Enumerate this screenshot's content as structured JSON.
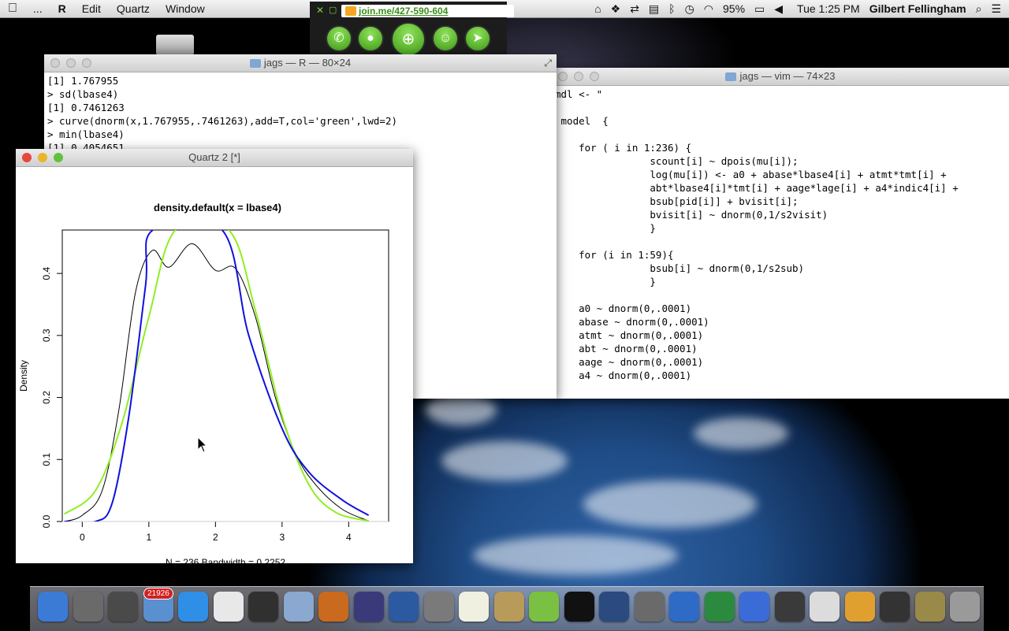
{
  "menubar": {
    "apple": "",
    "items": [
      "...",
      "R",
      "Edit",
      "Quartz",
      "Window"
    ],
    "battery": "95%",
    "clock": "Tue 1:25 PM",
    "user": "Gilbert Fellingham"
  },
  "joinme": {
    "url": "join.me/427-590-604"
  },
  "r_console": {
    "title": "jags — R — 80×24",
    "lines": [
      "[1] 1.767955",
      "> sd(lbase4)",
      "[1] 0.7461263",
      "> curve(dnorm(x,1.767955,.7461263),add=T,col='green',lwd=2)",
      "> min(lbase4)",
      "[1] 0.4054651"
    ]
  },
  "vim": {
    "title": "jags — vim — 74×23",
    "lines": [
      "mdl <- \"",
      "",
      " model  {",
      "",
      "    for ( i in 1:236) {",
      "                scount[i] ~ dpois(mu[i]);",
      "                log(mu[i]) <- a0 + abase*lbase4[i] + atmt*tmt[i] +",
      "                abt*lbase4[i]*tmt[i] + aage*lage[i] + a4*indic4[i] +",
      "                bsub[pid[i]] + bvisit[i];",
      "                bvisit[i] ~ dnorm(0,1/s2visit)",
      "                }",
      "",
      "    for (i in 1:59){",
      "                bsub[i] ~ dnorm(0,1/s2sub)",
      "                }",
      "",
      "    a0 ~ dnorm(0,.0001)",
      "    abase ~ dnorm(0,.0001)",
      "    atmt ~ dnorm(0,.0001)",
      "    abt ~ dnorm(0,.0001)",
      "    aage ~ dnorm(0,.0001)",
      "    a4 ~ dnorm(0,.0001)"
    ]
  },
  "quartz": {
    "title": "Quartz 2 [*]",
    "colors": {
      "density": "#000000",
      "normal": "#90ee22",
      "fit": "#1010e0"
    }
  },
  "chart_data": {
    "type": "line",
    "title": "density.default(x = lbase4)",
    "xlabel": "N = 236   Bandwidth = 0.2252",
    "ylabel": "Density",
    "xlim": [
      -0.3,
      4.6
    ],
    "ylim": [
      0,
      0.47
    ],
    "xticks": [
      "0",
      "1",
      "2",
      "3",
      "4"
    ],
    "yticks": [
      "0.0",
      "0.1",
      "0.2",
      "0.3",
      "0.4"
    ],
    "series": [
      {
        "color": "#000000",
        "points": [
          [
            -0.27,
            0.0
          ],
          [
            0.0,
            0.01
          ],
          [
            0.3,
            0.05
          ],
          [
            0.55,
            0.18
          ],
          [
            0.8,
            0.37
          ],
          [
            1.05,
            0.437
          ],
          [
            1.3,
            0.41
          ],
          [
            1.65,
            0.448
          ],
          [
            2.0,
            0.405
          ],
          [
            2.3,
            0.408
          ],
          [
            2.6,
            0.33
          ],
          [
            2.9,
            0.2
          ],
          [
            3.2,
            0.11
          ],
          [
            3.5,
            0.06
          ],
          [
            3.9,
            0.02
          ],
          [
            4.3,
            0.001
          ]
        ]
      },
      {
        "color": "#90ee22",
        "points": [
          [
            -0.27,
            0.012
          ],
          [
            0.2,
            0.05
          ],
          [
            0.6,
            0.16
          ],
          [
            1.0,
            0.33
          ],
          [
            1.4,
            0.47
          ],
          [
            2.2,
            0.47
          ],
          [
            2.6,
            0.34
          ],
          [
            3.0,
            0.17
          ],
          [
            3.4,
            0.06
          ],
          [
            3.8,
            0.015
          ],
          [
            4.3,
            0.001
          ]
        ]
      },
      {
        "color": "#1010e0",
        "points": [
          [
            -0.27,
            0.0
          ],
          [
            0.2,
            0.0
          ],
          [
            0.45,
            0.03
          ],
          [
            0.7,
            0.17
          ],
          [
            0.95,
            0.38
          ],
          [
            1.06,
            0.47
          ],
          [
            2.1,
            0.47
          ],
          [
            2.5,
            0.3
          ],
          [
            3.0,
            0.15
          ],
          [
            3.4,
            0.08
          ],
          [
            3.9,
            0.035
          ],
          [
            4.3,
            0.01
          ]
        ]
      }
    ]
  },
  "dock": {
    "mail_badge": "21926",
    "apps": [
      "Finder",
      "Launchpad",
      "Preview",
      "Mail",
      "App Store",
      "Chrome",
      "Dashboard",
      "iPhoto",
      "Firefox",
      "R",
      "Pandora",
      "LaTeX",
      "TextEdit",
      "Contacts",
      "join.me",
      "Terminal",
      "VMware",
      "System Preferences",
      "Word",
      "Excel",
      "iTunes",
      "Camera",
      "PDF",
      "X11",
      "Blank",
      "Utility",
      "Trash"
    ]
  }
}
